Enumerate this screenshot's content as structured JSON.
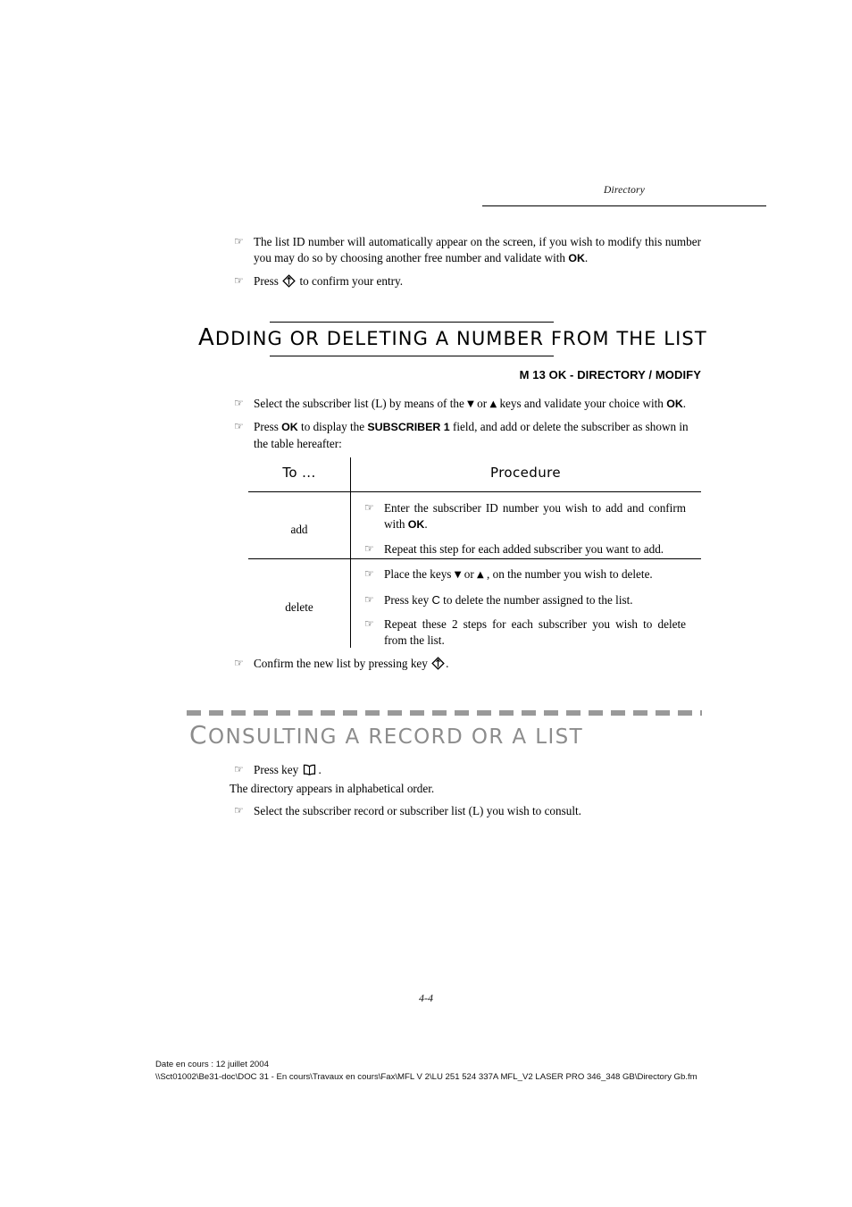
{
  "header": {
    "chapter_title": "Directory"
  },
  "intro_bullets": [
    {
      "id": "modify-id-number",
      "before": "The list ID number will automatically appear on the screen, if you wish to modify this number you may do so by choosing another free number and validate with ",
      "bold": "OK",
      "after": "."
    },
    {
      "id": "confirm-entry",
      "before": "Press ",
      "icon": "diamond-validate-key-icon",
      "after": " to confirm your entry."
    }
  ],
  "section": {
    "heading_first_letter": "A",
    "heading_rest": "DDING OR DELETING A NUMBER FROM THE LIST",
    "heading_full": "ADDING OR DELETING A NUMBER FROM THE LIST",
    "menu_path": "M 13 OK - DIRECTORY / MODIFY",
    "bullets": [
      {
        "id": "select-subscriber-list",
        "p1": "Select the subscriber list (L) by means of the ",
        "arrow_down": "▼",
        "p2": " or ",
        "arrow_up": "▲",
        "p3": " keys and validate your choice with ",
        "bold": "OK",
        "p4": "."
      },
      {
        "id": "press-ok-subscriber-field",
        "p1": "Press ",
        "bold1": "OK",
        "p2": " to display the ",
        "bold2": "SUBSCRIBER 1",
        "p3": " field, and add or delete the subscriber as shown in the table hereafter:"
      }
    ]
  },
  "table": {
    "columns": [
      "To ...",
      "Procedure"
    ],
    "rows": [
      {
        "label": "add",
        "steps": [
          {
            "id": "enter-subscriber-id",
            "before": "Enter the subscriber ID number you wish to add and confirm with ",
            "bold": "OK",
            "after": "."
          },
          {
            "id": "repeat-for-each-added",
            "before": "Repeat this step for each added subscriber you want to add.",
            "bold": "",
            "after": ""
          }
        ]
      },
      {
        "label": "delete",
        "steps": [
          {
            "id": "place-keys-on-number",
            "before": "Place the keys ",
            "arrow_down": "▼",
            "mid": " or ",
            "arrow_up": "▲",
            "after": " , on the number you wish to delete."
          },
          {
            "id": "press-key-c",
            "before": "Press key ",
            "key": "C",
            "after": " to delete the number assigned to the list."
          },
          {
            "id": "repeat-two-steps",
            "before": "Repeat these 2 steps for each subscriber you wish to delete from the list.",
            "after": ""
          }
        ]
      }
    ]
  },
  "after_table_bullet": {
    "id": "confirm-new-list",
    "before": "Confirm the new list by pressing key ",
    "icon": "diamond-validate-key-icon",
    "after": "."
  },
  "gray_section": {
    "heading_first_letter": "C",
    "heading_rest": "ONSULTING A RECORD OR A LIST",
    "heading_full": "CONSULTING A RECORD OR A LIST",
    "band_color": "#999999",
    "text_color": "#8c8c8c",
    "bullets": [
      {
        "id": "press-directory-key",
        "before": "Press key ",
        "icon": "open-book-directory-key-icon",
        "after": "."
      }
    ],
    "note": "The directory appears in alphabetical order.",
    "bullets2": [
      {
        "id": "select-record-or-list",
        "before": "Select the subscriber record or subscriber list (L) you wish to consult.",
        "after": ""
      }
    ]
  },
  "footer": {
    "page_number": "4-4",
    "date_line": "Date en cours : 12 juillet 2004",
    "path_line": "\\\\Sct01002\\Be31-doc\\DOC 31 - En cours\\Travaux en cours\\Fax\\MFL V 2\\LU 251 524 337A MFL_V2 LASER PRO 346_348 GB\\Directory Gb.fm"
  },
  "glyphs": {
    "hand_bullet": "☞"
  }
}
